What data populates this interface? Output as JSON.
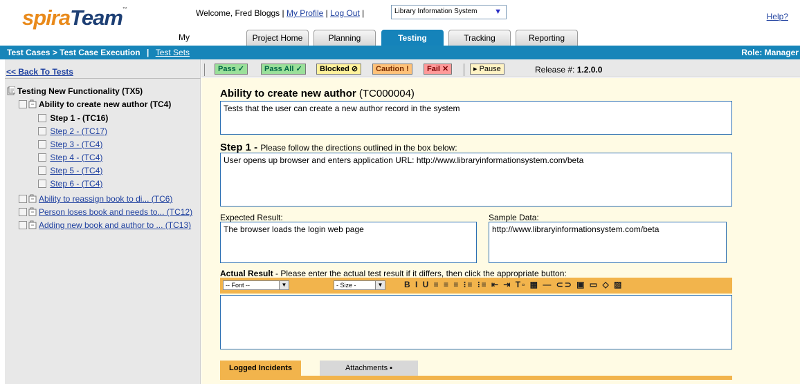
{
  "header": {
    "logo_spira": "spira",
    "logo_team": "Team",
    "logo_tm": "™",
    "welcome_text": "Welcome, Fred Bloggs",
    "my_profile": "My Profile",
    "log_out": "Log Out",
    "project": "Library Information System",
    "help": "Help?"
  },
  "tabs": [
    {
      "label": "My Page"
    },
    {
      "label": "Project Home"
    },
    {
      "label": "Planning"
    },
    {
      "label": "Testing"
    },
    {
      "label": "Tracking"
    },
    {
      "label": "Reporting"
    }
  ],
  "subbar": {
    "breadcrumb": "Test Cases > Test Case Execution",
    "sep": "|",
    "test_sets": "Test Sets",
    "role": "Role: Manager"
  },
  "sidebar": {
    "back": "<< Back To Tests",
    "root": "Testing New Functionality (TX5)",
    "test_case": "Ability to create new author (TC4)",
    "steps": [
      "Step 1 - (TC16)",
      "Step 2 - (TC17)",
      "Step 3 - (TC4)",
      "Step 4 - (TC4)",
      "Step 5 - (TC4)",
      "Step 6 - (TC4)"
    ],
    "other_cases": [
      "Ability to reassign book to di... (TC6)",
      "Person loses book and needs to... (TC12)",
      "Adding new book and author to ... (TC13)"
    ]
  },
  "toolbar": {
    "pass": "Pass ✓",
    "pass_all": "Pass All ✓",
    "blocked": "Blocked ⊘",
    "caution": "Caution !",
    "fail": "Fail ✕",
    "pause": "▸ Pause",
    "release_label": "Release #:",
    "release_value": "1.2.0.0"
  },
  "main": {
    "title": "Ability to create new author",
    "title_id": "(TC000004)",
    "description": "Tests that the user can create a new author record in the system",
    "step_title": "Step 1 -",
    "step_hint": "Please follow the directions outlined in the box below:",
    "step_text": "User opens up browser and enters application URL: http://www.libraryinformationsystem.com/beta",
    "expected_label": "Expected Result:",
    "expected_text": "The browser loads the login web page",
    "sample_label": "Sample Data:",
    "sample_text": "http://www.libraryinformationsystem.com/beta",
    "actual_label": "Actual Result",
    "actual_hint": "- Please enter the actual test result if it differs, then click the appropriate button:",
    "font_select": "-- Font --",
    "size_select": "- Size -",
    "editor_icons": "B I U  ≡ ≡ ≡  ⁝≡ ⁝≡ ⇤ ⇥  T▫ ▦  — ⊂⊃ ▣ ▭ ◇ ▨"
  },
  "bottom_tabs": {
    "incidents": "Logged Incidents",
    "attachments": "Attachments ▪"
  }
}
